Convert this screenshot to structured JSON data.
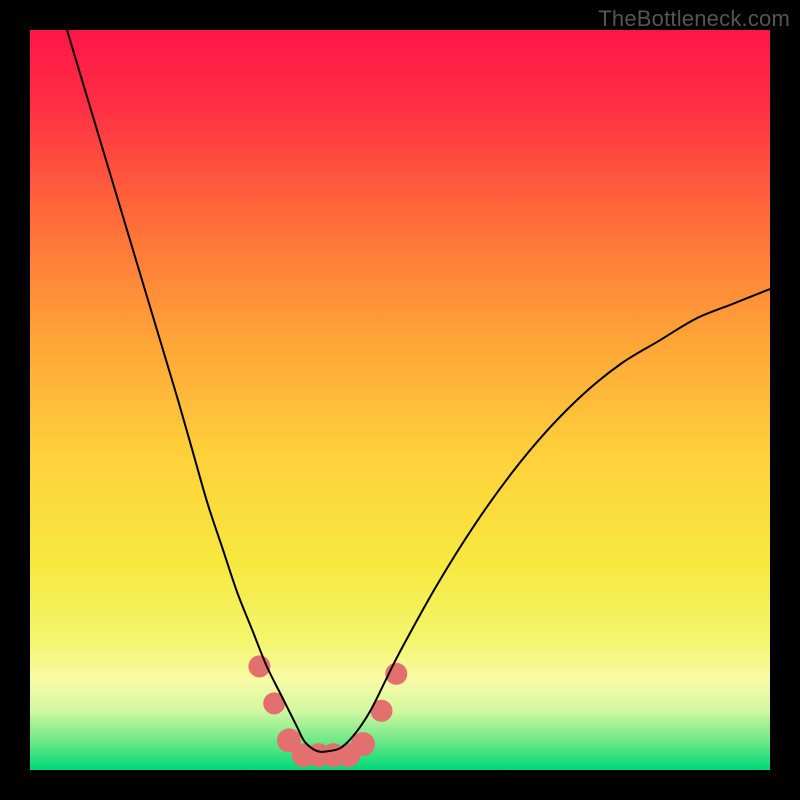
{
  "watermark": "TheBottleneck.com",
  "chart_data": {
    "type": "line",
    "title": "",
    "xlabel": "",
    "ylabel": "",
    "xlim": [
      0,
      100
    ],
    "ylim": [
      0,
      100
    ],
    "grid": false,
    "series": [
      {
        "name": "bottleneck-curve",
        "color": "#000000",
        "x": [
          5,
          8,
          11,
          14,
          17,
          20,
          22,
          24,
          26,
          28,
          30,
          32,
          34,
          36,
          37,
          38,
          39,
          40,
          42,
          44,
          46,
          48,
          50,
          55,
          60,
          65,
          70,
          75,
          80,
          85,
          90,
          95,
          100
        ],
        "y": [
          100,
          90,
          80,
          70,
          60,
          50,
          43,
          36,
          30,
          24,
          19,
          14,
          10,
          6,
          4,
          3,
          2.5,
          2.5,
          3,
          5,
          8,
          12,
          16,
          25,
          33,
          40,
          46,
          51,
          55,
          58,
          61,
          63,
          65
        ]
      }
    ],
    "markers": [
      {
        "x": 31,
        "y": 14,
        "color": "#e36f6f",
        "r": 11
      },
      {
        "x": 33,
        "y": 9,
        "color": "#e36f6f",
        "r": 11
      },
      {
        "x": 35,
        "y": 4,
        "color": "#e36f6f",
        "r": 12
      },
      {
        "x": 37,
        "y": 2,
        "color": "#e36f6f",
        "r": 12
      },
      {
        "x": 39,
        "y": 2,
        "color": "#e36f6f",
        "r": 12
      },
      {
        "x": 41,
        "y": 2,
        "color": "#e36f6f",
        "r": 12
      },
      {
        "x": 43,
        "y": 2,
        "color": "#e36f6f",
        "r": 12
      },
      {
        "x": 45,
        "y": 3.5,
        "color": "#e36f6f",
        "r": 12
      },
      {
        "x": 47.5,
        "y": 8,
        "color": "#e36f6f",
        "r": 11
      },
      {
        "x": 49.5,
        "y": 13,
        "color": "#e36f6f",
        "r": 11
      }
    ],
    "gradient_stops": [
      {
        "offset": 0.0,
        "color": "#ff1649"
      },
      {
        "offset": 0.1,
        "color": "#ff2e44"
      },
      {
        "offset": 0.25,
        "color": "#ff6a3a"
      },
      {
        "offset": 0.42,
        "color": "#ffa537"
      },
      {
        "offset": 0.58,
        "color": "#ffd23b"
      },
      {
        "offset": 0.72,
        "color": "#f7e83f"
      },
      {
        "offset": 0.82,
        "color": "#f3f56a"
      },
      {
        "offset": 0.88,
        "color": "#f8fba6"
      },
      {
        "offset": 0.92,
        "color": "#d2f7a0"
      },
      {
        "offset": 0.96,
        "color": "#6fe989"
      },
      {
        "offset": 1.0,
        "color": "#00d87a"
      }
    ]
  }
}
